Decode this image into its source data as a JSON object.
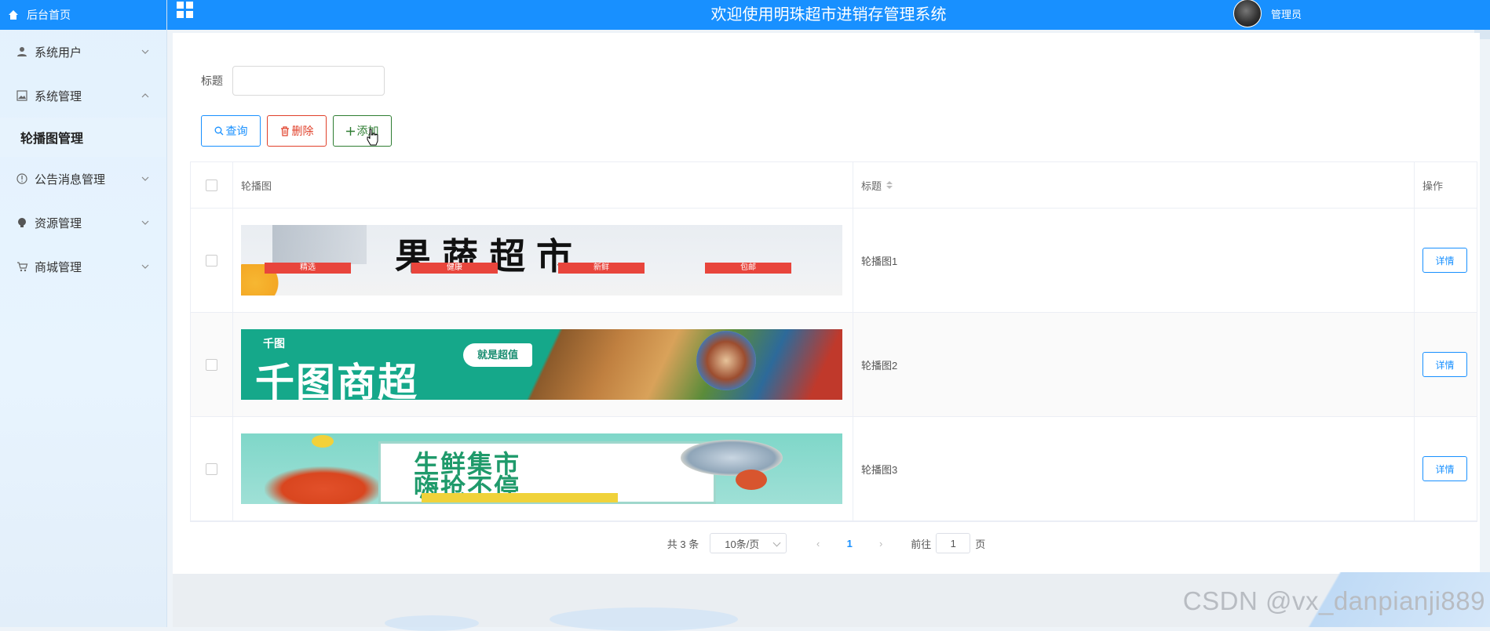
{
  "sidebar": {
    "home_label": "后台首页",
    "items": [
      {
        "label": "系统用户",
        "icon": "user-icon"
      },
      {
        "label": "系统管理",
        "icon": "image-icon"
      },
      {
        "label": "公告消息管理",
        "icon": "info-icon"
      },
      {
        "label": "资源管理",
        "icon": "bulb-icon"
      },
      {
        "label": "商城管理",
        "icon": "cart-icon"
      }
    ],
    "sub_item": "轮播图管理"
  },
  "header": {
    "title": "欢迎使用明珠超市进销存管理系统",
    "user": "管理员",
    "accent": "#1890ff"
  },
  "search": {
    "label": "标题",
    "value": ""
  },
  "toolbar": {
    "query_label": "查询",
    "delete_label": "删除",
    "add_label": "添加"
  },
  "table": {
    "columns": [
      "轮播图",
      "标题",
      "操作"
    ],
    "rows": [
      {
        "banner_text": "果蔬超市",
        "banner_tags": [
          "精选",
          "健康",
          "新鲜",
          "包邮"
        ],
        "title": "轮播图1",
        "action": "详情"
      },
      {
        "banner_text": "千图商超",
        "banner_logo": "千图",
        "banner_tag": "就是超值",
        "title": "轮播图2",
        "action": "详情"
      },
      {
        "banner_text_1": "生鲜集市",
        "banner_text_2": "嗨抢不停",
        "title": "轮播图3",
        "action": "详情"
      }
    ]
  },
  "pagination": {
    "total": "共 3 条",
    "page_size": "10条/页",
    "current_page": "1",
    "goto_prefix": "前往",
    "goto_value": "1",
    "goto_suffix": "页"
  },
  "watermark": "CSDN @vx_danpianji889"
}
